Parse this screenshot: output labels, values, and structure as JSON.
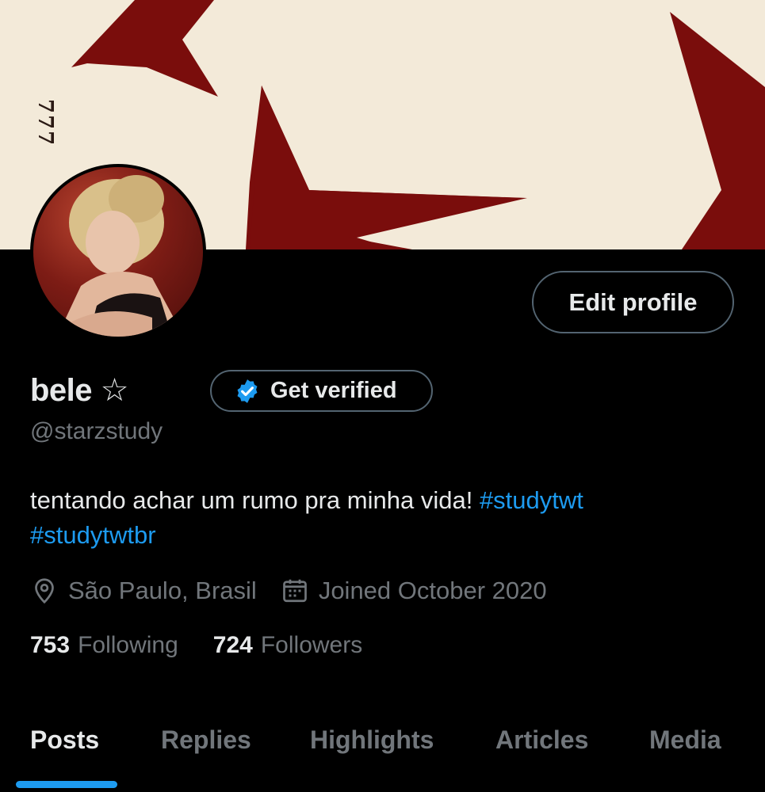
{
  "banner": {
    "mark": "777"
  },
  "profile": {
    "display_name": "bele ☆",
    "handle": "@starzstudy",
    "edit_label": "Edit profile",
    "verify_label": "Get verified",
    "bio_text": "tentando achar um rumo pra minha vida!",
    "bio_tags": [
      "#studytwt",
      "#studytwtbr"
    ],
    "location": "São Paulo, Brasil",
    "joined": "Joined October 2020",
    "following_count": "753",
    "following_label": "Following",
    "followers_count": "724",
    "followers_label": "Followers"
  },
  "tabs": [
    {
      "label": "Posts",
      "active": true
    },
    {
      "label": "Replies",
      "active": false
    },
    {
      "label": "Highlights",
      "active": false
    },
    {
      "label": "Articles",
      "active": false
    },
    {
      "label": "Media",
      "active": false
    }
  ],
  "colors": {
    "accent": "#1d9bf0",
    "banner_bg": "#f3ead9",
    "banner_star": "#7a0d0c",
    "muted_text": "#71767b",
    "border": "#536471"
  },
  "icons": {
    "location": "location-pin-icon",
    "calendar": "calendar-icon",
    "verified": "verified-badge-icon"
  }
}
